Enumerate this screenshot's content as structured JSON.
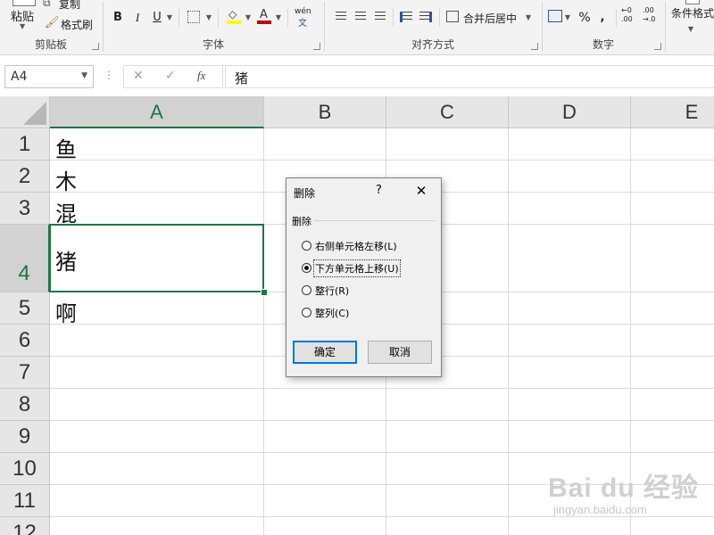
{
  "ribbon": {
    "clipboard": {
      "paste": "粘贴",
      "copy": "复制",
      "format_painter": "格式刷",
      "group_label": "剪贴板"
    },
    "font": {
      "bold": "B",
      "italic": "I",
      "underline": "U",
      "font_color": "A",
      "wen": "wén",
      "wen_char": "文",
      "group_label": "字体"
    },
    "alignment": {
      "merge_center": "合并后居中",
      "group_label": "对齐方式"
    },
    "number": {
      "percent": "%",
      "comma": ",",
      "inc_decimal_top": "←0",
      "inc_decimal_bottom": ".00",
      "dec_decimal_top": ".00",
      "dec_decimal_bottom": "→.0",
      "group_label": "数字"
    },
    "styles": {
      "conditional_format": "条件格式"
    }
  },
  "formula_bar": {
    "name_box": "A4",
    "cancel_symbol": "✕",
    "enter_symbol": "✓",
    "fx": "fx",
    "content": "猪"
  },
  "grid": {
    "columns": [
      "A",
      "B",
      "C",
      "D",
      "E"
    ],
    "selected_column": "A",
    "rows": [
      "1",
      "2",
      "3",
      "4",
      "5",
      "6",
      "7",
      "8",
      "9",
      "10",
      "11",
      "12"
    ],
    "selected_row": "4",
    "cells": {
      "A1": "鱼",
      "A2": "木",
      "A3": "混",
      "A4": "猪",
      "A5": "啊"
    }
  },
  "dialog": {
    "title": "删除",
    "help": "?",
    "close": "✕",
    "section_label": "删除",
    "options": [
      {
        "label": "右侧单元格左移(L)",
        "checked": false
      },
      {
        "label": "下方单元格上移(U)",
        "checked": true
      },
      {
        "label": "整行(R)",
        "checked": false
      },
      {
        "label": "整列(C)",
        "checked": false
      }
    ],
    "ok_label": "确定",
    "cancel_label": "取消"
  },
  "watermark": {
    "logo": "Bai du 经验",
    "sub": "jingyan.baidu.com"
  },
  "colors": {
    "accent_green": "#217346",
    "focus_blue": "#0078d7",
    "font_color_red": "#c00000",
    "highlight_yellow": "#ffff00"
  }
}
